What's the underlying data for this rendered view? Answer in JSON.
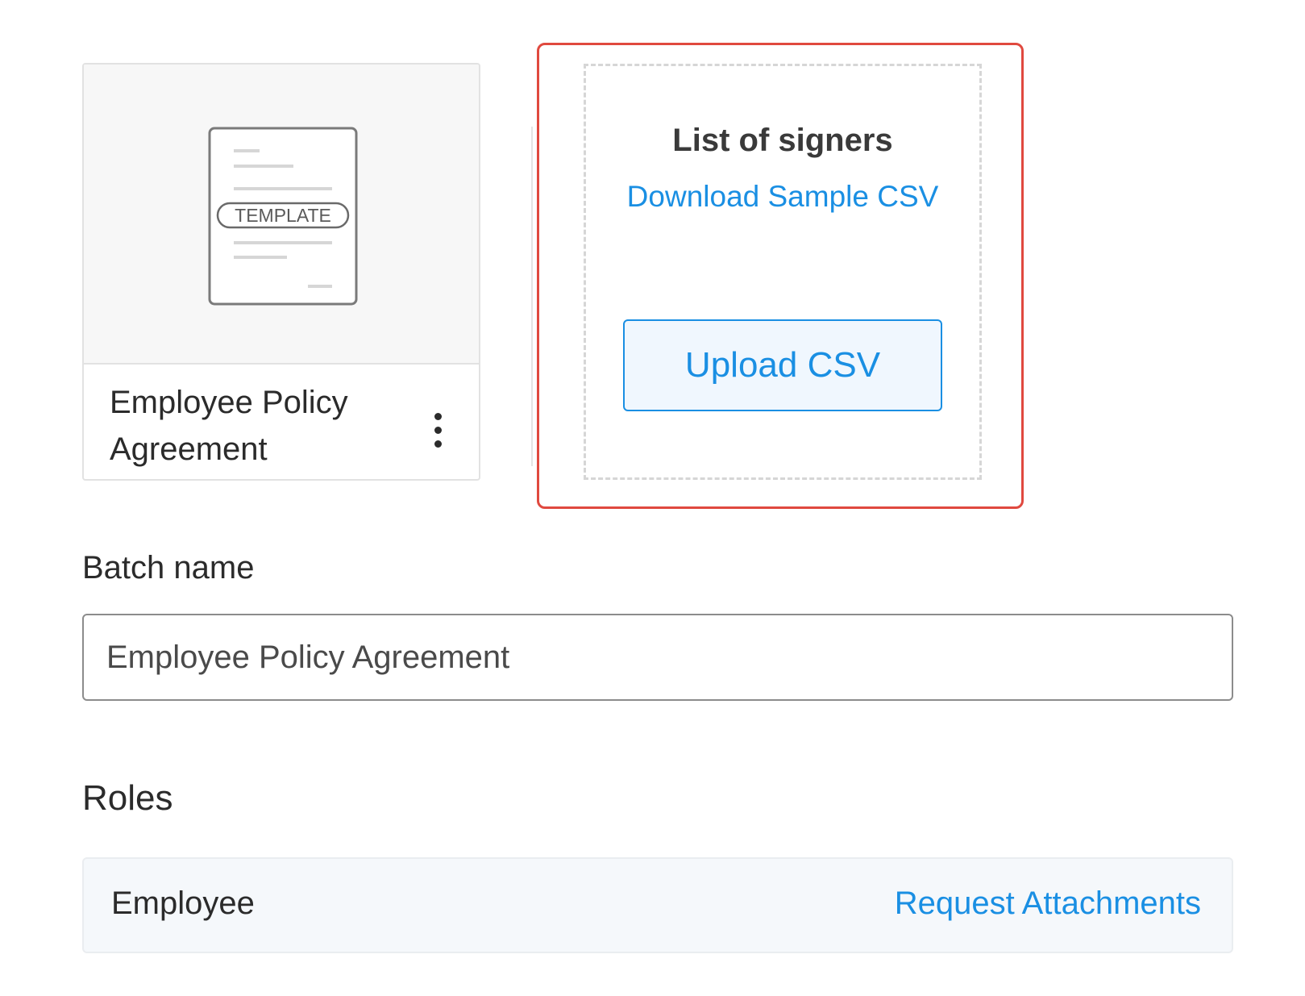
{
  "template_card": {
    "badge": "TEMPLATE",
    "title": "Employee Policy Agreement"
  },
  "signers_upload": {
    "title": "List of signers",
    "download_link": "Download Sample CSV",
    "upload_button": "Upload CSV"
  },
  "batch": {
    "label": "Batch name",
    "value": "Employee Policy Agreement"
  },
  "roles": {
    "heading": "Roles",
    "items": [
      {
        "name": "Employee",
        "action": "Request Attachments"
      }
    ]
  },
  "colors": {
    "link_blue": "#1a8fe3",
    "highlight_red": "#e0493f"
  }
}
